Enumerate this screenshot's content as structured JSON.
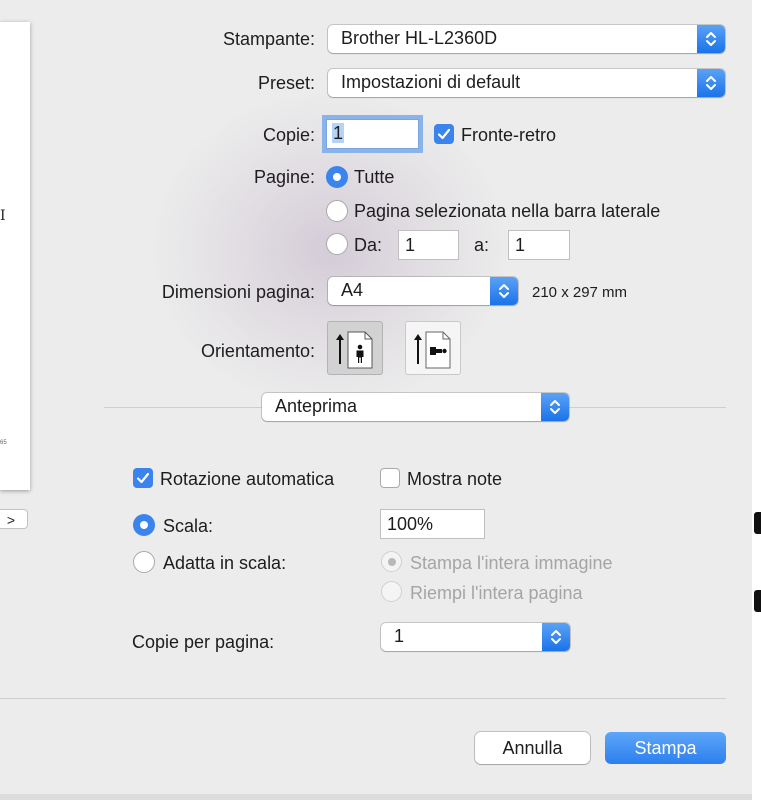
{
  "printer": {
    "label": "Stampante:",
    "value": "Brother HL-L2360D"
  },
  "preset": {
    "label": "Preset:",
    "value": "Impostazioni di default"
  },
  "copies": {
    "label": "Copie:",
    "value": "1",
    "duplex_label": "Fronte-retro",
    "duplex_checked": true
  },
  "pages": {
    "label": "Pagine:",
    "all_label": "Tutte",
    "sidebar_label": "Pagina selezionata nella barra laterale",
    "from_label": "Da:",
    "from_value": "1",
    "to_label": "a:",
    "to_value": "1",
    "selected": "all"
  },
  "paper_size": {
    "label": "Dimensioni pagina:",
    "value": "A4",
    "dimensions": "210 x 297 mm"
  },
  "orientation": {
    "label": "Orientamento:",
    "selected": "portrait",
    "options": [
      "portrait",
      "landscape"
    ]
  },
  "section": {
    "value": "Anteprima"
  },
  "preview_options": {
    "auto_rotate_label": "Rotazione automatica",
    "auto_rotate_checked": true,
    "show_notes_label": "Mostra note",
    "show_notes_checked": false,
    "scale_label": "Scala:",
    "scale_value": "100%",
    "fit_label": "Adatta in scala:",
    "print_entire_label": "Stampa l'intera immagine",
    "fill_page_label": "Riempi l'intera pagina",
    "selected": "scale"
  },
  "pages_per_sheet": {
    "label": "Copie per pagina:",
    "value": "1"
  },
  "preview_side": {
    "glyph": "I",
    "nav": ">"
  },
  "actions": {
    "cancel": "Annulla",
    "print": "Stampa"
  },
  "colors": {
    "accent": "#3b84ee",
    "primary_button": "#2b7ff0",
    "background": "#ececec"
  },
  "icons": {
    "popup": "chevron-updown-icon",
    "checkbox": "checkmark-icon",
    "portrait": "portrait-orientation-icon",
    "landscape": "landscape-orientation-icon"
  }
}
